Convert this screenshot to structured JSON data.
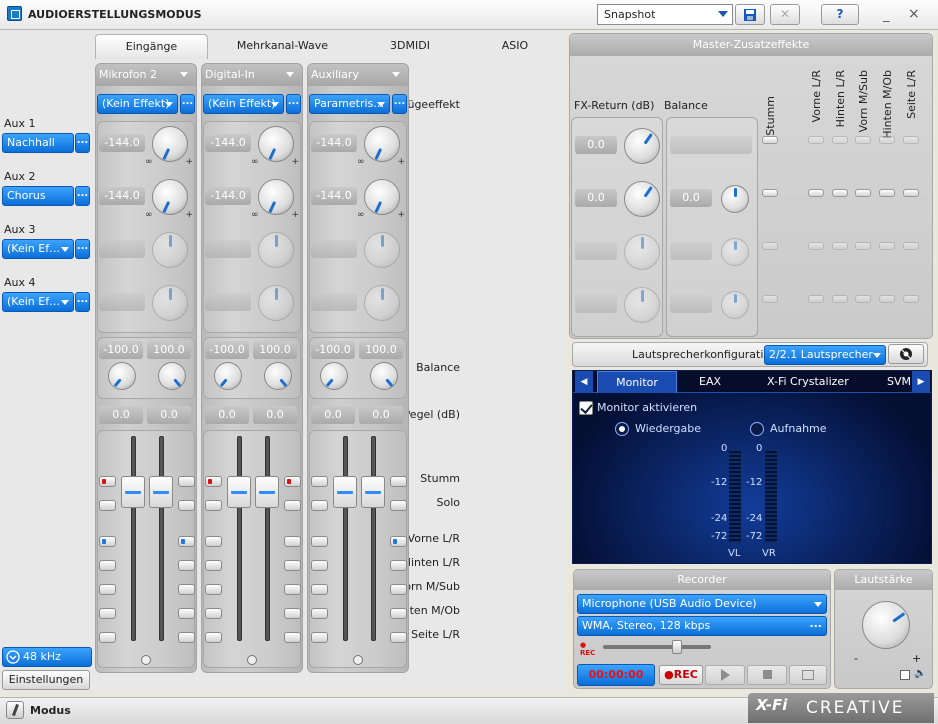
{
  "window": {
    "title": "AUDIOERSTELLUNGSMODUS",
    "snapshot_value": "Snapshot",
    "save_icon": "save-icon",
    "delete_icon": "close-icon",
    "help_label": "?",
    "minimize": "_",
    "close": "×"
  },
  "tabs": [
    {
      "label": "Eingänge",
      "active": true
    },
    {
      "label": "Mehrkanal-Wave"
    },
    {
      "label": "3DMIDI"
    },
    {
      "label": "ASIO"
    }
  ],
  "row_labels": {
    "insert_effect": "Einfügeeffekt",
    "aux1": "Aux 1",
    "aux2": "Aux 2",
    "aux3": "Aux 3",
    "aux4": "Aux 4",
    "balance": "Balance",
    "level": "Pegel (dB)",
    "mute": "Stumm",
    "solo": "Solo",
    "front": "Vorne L/R",
    "rear": "Hinten L/R",
    "center": "Vorn M/Sub",
    "rear_top": "Hinten M/Ob",
    "side": "Seite L/R"
  },
  "aux_effects": {
    "aux1": "Nachhall",
    "aux2": "Chorus",
    "aux3": "(Kein Ef…",
    "aux4": "(Kein Ef…"
  },
  "dots": "...",
  "channels": [
    {
      "name": "Mikrofon 2",
      "effect": "(Kein Effekt)",
      "aux1": "-144.0",
      "aux2": "-144.0",
      "bal_l": "-100.0",
      "bal_r": "100.0",
      "lvl_l": "0.0",
      "lvl_r": "0.0"
    },
    {
      "name": "Digital-In",
      "effect": "(Kein Effekt)",
      "aux1": "-144.0",
      "aux2": "-144.0",
      "bal_l": "-100.0",
      "bal_r": "100.0",
      "lvl_l": "0.0",
      "lvl_r": "0.0"
    },
    {
      "name": "Auxiliary",
      "effect": "Parametris…",
      "aux1": "-144.0",
      "aux2": "-144.0",
      "bal_l": "-100.0",
      "bal_r": "100.0",
      "lvl_l": "0.0",
      "lvl_r": "0.0"
    }
  ],
  "knob_marks": {
    "inf": "∞",
    "plus": "+"
  },
  "sample_rate": "48 kHz",
  "settings_button": "Einstellungen",
  "master": {
    "title": "Master-Zusatzeffekte",
    "fx_return": "FX-Return (dB)",
    "balance": "Balance",
    "columns": [
      "Stumm",
      "Vorne L/R",
      "Hinten L/R",
      "Vorn M/Sub",
      "Hinten M/Ob",
      "Seite L/R"
    ],
    "fx1": "0.0",
    "fx2": "0.0",
    "bal2": "0.0"
  },
  "speaker": {
    "label": "Lautsprecherkonfiguration:",
    "value": "2/2.1 Lautsprecher"
  },
  "monitor": {
    "tabs": [
      "Monitor",
      "EAX",
      "X-Fi Crystalizer",
      "SVM"
    ],
    "enable": "Monitor aktivieren",
    "playback": "Wiedergabe",
    "record": "Aufnahme",
    "scale": [
      "0",
      "-12",
      "-24",
      "-72"
    ],
    "vl": "VL",
    "vr": "VR"
  },
  "recorder": {
    "title": "Recorder",
    "device": "Microphone (USB Audio Device)",
    "format": "WMA, Stereo, 128 kbps",
    "rec_small": "REC",
    "time": "00:00:00",
    "rec_button": "●REC"
  },
  "volume": {
    "title": "Lautstärke",
    "minus": "-",
    "plus": "+"
  },
  "status": {
    "mode": "Modus"
  },
  "brand": {
    "xfi": "X-Fi",
    "creative": "CREATIVE"
  },
  "colors": {
    "accent": "#1a7ae0",
    "panel_blue": "#0a2a7a",
    "rec_red": "#d11111"
  }
}
